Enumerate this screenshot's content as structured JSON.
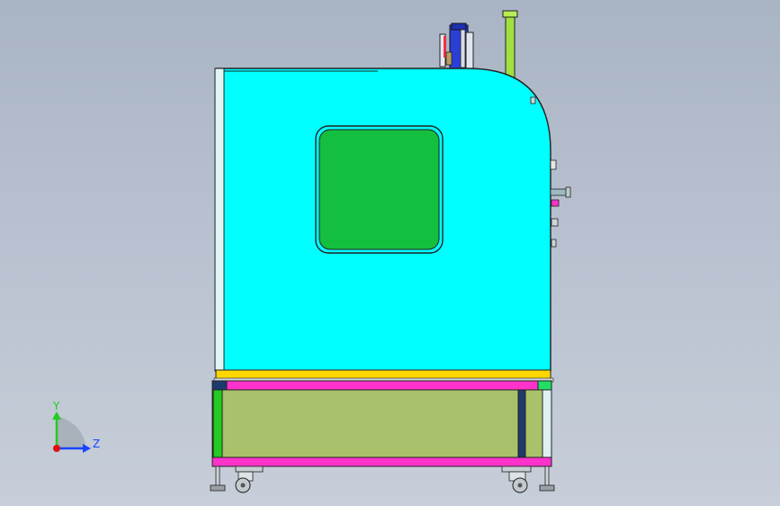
{
  "viewport": {
    "background_top": "#a9b4c4",
    "background_bottom": "#c7ced9"
  },
  "colors": {
    "cabinet_body": "#00ffff",
    "window_glass": "#14bf3f",
    "yellow_rail": "#ffd700",
    "magenta_rail": "#ff33cc",
    "base_panel": "#a9c16a",
    "green_post": "#22cc22",
    "navy_post": "#1d3a6b",
    "pipe_green": "#a0e040",
    "outline": "#222222"
  },
  "triad": {
    "y_label": "Y",
    "z_label": "Z",
    "y_color": "#22cc22",
    "z_color": "#1a44ff",
    "origin_color": "#dd1111"
  }
}
